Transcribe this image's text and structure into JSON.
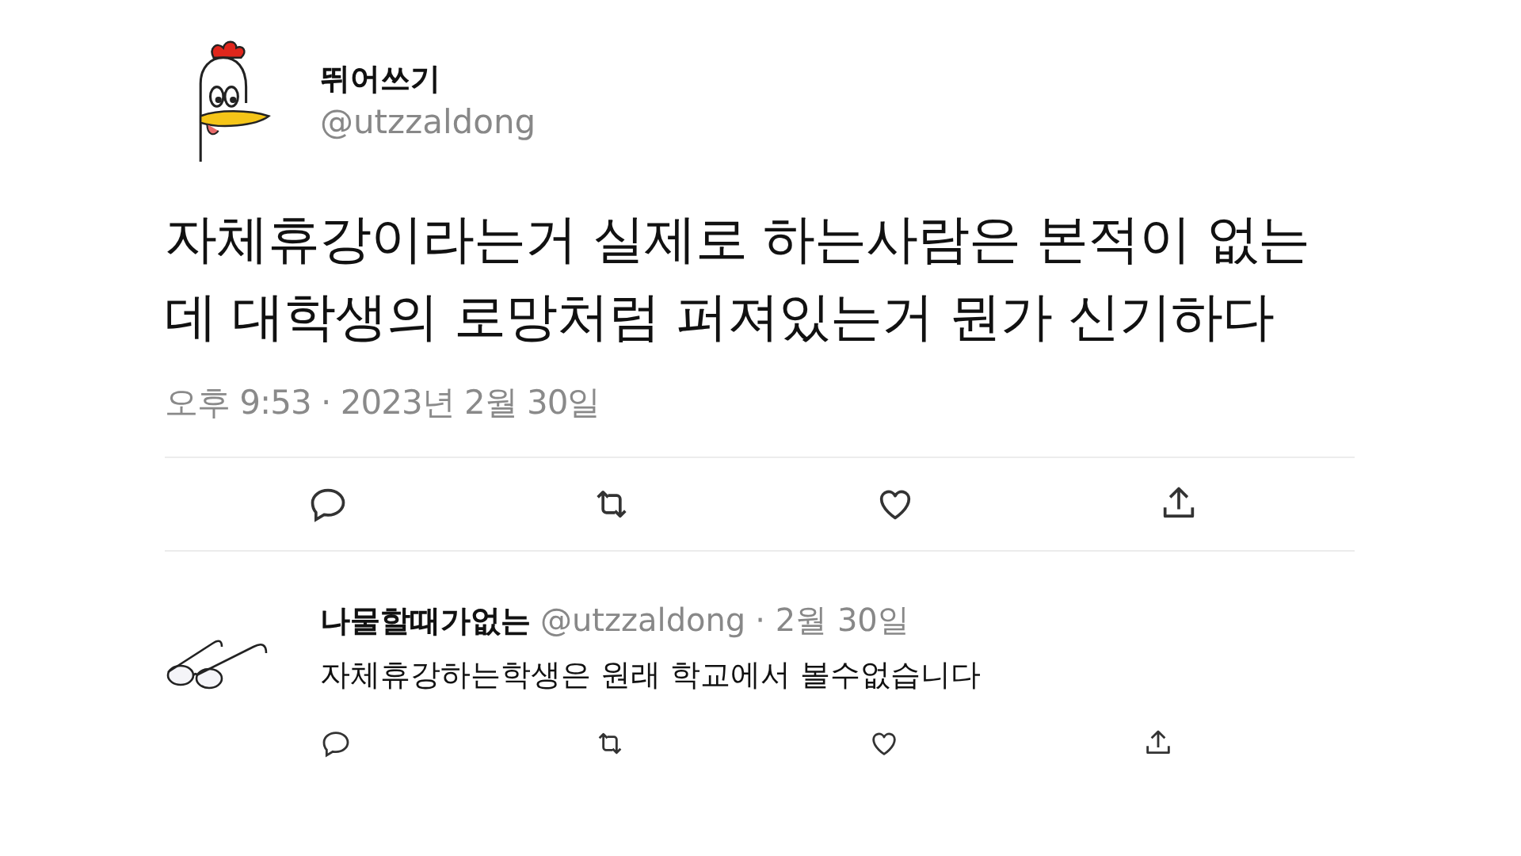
{
  "tweet": {
    "author": {
      "name": "뛰어쓰기",
      "handle": "@utzzaldong"
    },
    "text_lines": [
      "자체휴강이라는거 실제로 하는사람은 본적이 없는",
      "데 대학생의 로망처럼 퍼져있는거 뭔가 신기하다"
    ],
    "timestamp": "오후 9:53 · 2023년 2월 30일"
  },
  "reply": {
    "author": {
      "name": "나물할때가없는",
      "handle": "@utzzaldong"
    },
    "date": "· 2월 30일",
    "text": "자체휴강하는학생은 원래 학교에서 볼수없습니다"
  }
}
